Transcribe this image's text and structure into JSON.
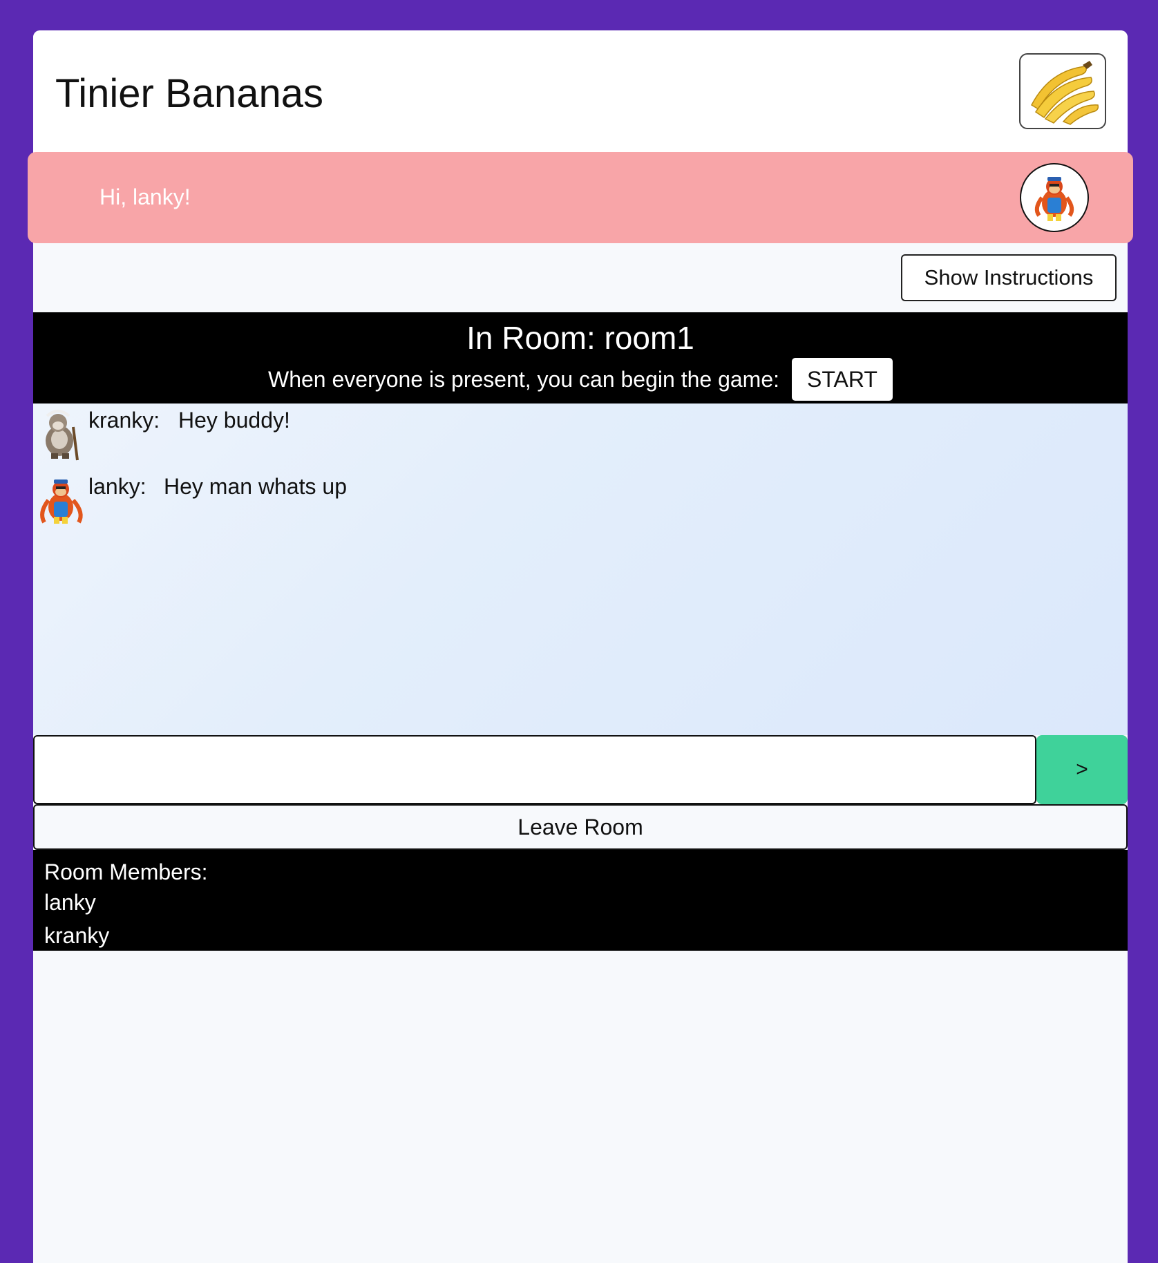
{
  "header": {
    "title": "Tinier Bananas",
    "logo_icon": "banana-bunch-icon"
  },
  "greeting": {
    "text": "Hi, lanky!",
    "avatar_icon": "lanky-kong-avatar"
  },
  "controls": {
    "show_instructions_label": "Show Instructions"
  },
  "room": {
    "title": "In Room: room1",
    "begin_prompt": "When everyone is present, you can begin the game:",
    "start_label": "START"
  },
  "chat": {
    "messages": [
      {
        "user": "kranky:",
        "text": "Hey buddy!",
        "avatar_icon": "cranky-kong-avatar"
      },
      {
        "user": "lanky:",
        "text": "Hey man whats up",
        "avatar_icon": "lanky-kong-avatar"
      }
    ],
    "input_value": "",
    "send_label": ">"
  },
  "leave_label": "Leave Room",
  "members": {
    "heading": "Room Members:",
    "list": [
      "lanky",
      "kranky"
    ]
  },
  "colors": {
    "background": "#5b29b3",
    "greeting_bar": "#f8a5a8",
    "send_button": "#3fd29a"
  }
}
